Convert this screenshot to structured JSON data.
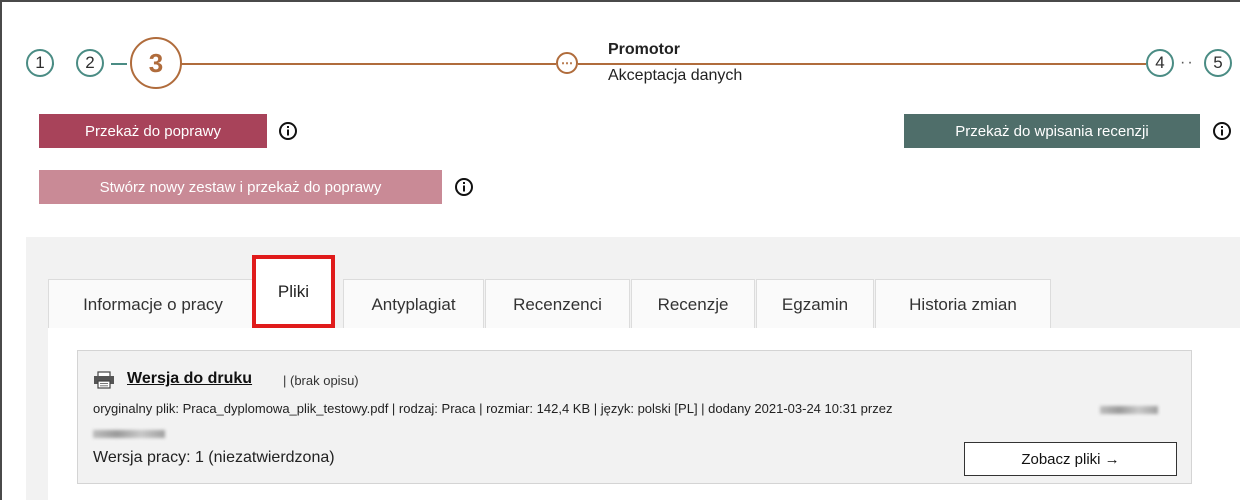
{
  "stepper": {
    "steps": [
      "1",
      "2",
      "3",
      "4",
      "5"
    ],
    "current_substep_symbol": "⋯",
    "dots": "··",
    "title": "Promotor",
    "subtitle": "Akceptacja danych"
  },
  "actions": {
    "fix_label": "Przekaż do poprawy",
    "new_set_label": "Stwórz nowy zestaw i przekaż do poprawy",
    "review_label": "Przekaż do wpisania recenzji"
  },
  "tabs": [
    {
      "label": "Informacje o pracy"
    },
    {
      "label": "Pliki"
    },
    {
      "label": "Antyplagiat"
    },
    {
      "label": "Recenzenci"
    },
    {
      "label": "Recenzje"
    },
    {
      "label": "Egzamin"
    },
    {
      "label": "Historia zmian"
    }
  ],
  "file": {
    "title": "Wersja do druku",
    "description": "| (brak opisu)",
    "meta": "oryginalny plik: Praca_dyplomowa_plik_testowy.pdf | rodzaj: Praca | rozmiar: 142,4 KB | język: polski [PL] | dodany 2021-03-24 10:31 przez",
    "version": "Wersja pracy: 1 (niezatwierdzona)",
    "see_files_label": "Zobacz pliki →"
  },
  "colors": {
    "accent_orange": "#b06c3c",
    "step_teal": "#4a8c84",
    "btn_fix": "#a8435a",
    "btn_new": "#c98a96",
    "btn_review": "#4f6e6a",
    "highlight_red": "#e01b1b"
  }
}
